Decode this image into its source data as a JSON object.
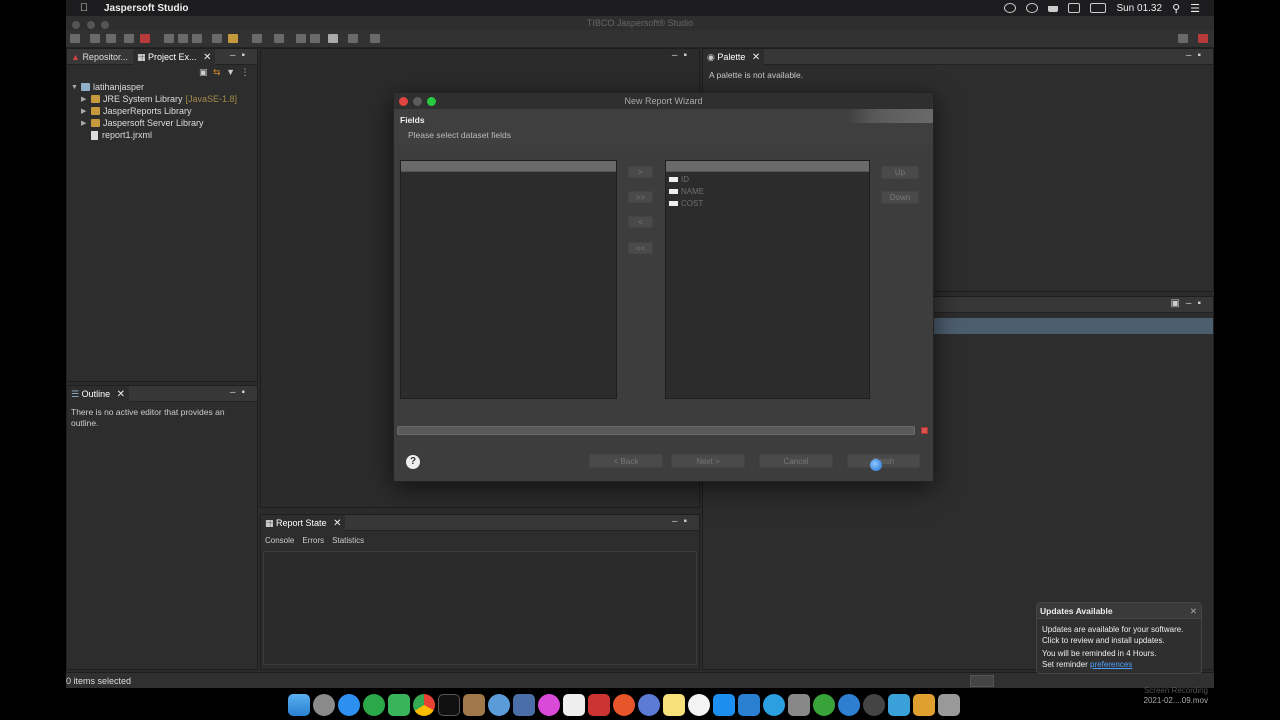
{
  "menubar": {
    "app_name": "Jaspersoft Studio",
    "clock": "Sun 01.32"
  },
  "window": {
    "title": "TIBCO Jaspersoft® Studio"
  },
  "project_panel": {
    "tabs": [
      {
        "label": "Repositor..."
      },
      {
        "label": "Project Ex..."
      }
    ],
    "tree": {
      "root": "latihanjasper",
      "items": [
        {
          "label": "JRE System Library",
          "suffix": "[JavaSE-1.8]"
        },
        {
          "label": "JasperReports Library"
        },
        {
          "label": "Jaspersoft Server Library"
        },
        {
          "label": "report1.jrxml"
        }
      ]
    }
  },
  "outline_panel": {
    "tab": "Outline",
    "message": "There is no active editor that provides an outline."
  },
  "palette_panel": {
    "tab": "Palette",
    "message": "A palette is not available."
  },
  "report_state_panel": {
    "tab": "Report State",
    "subtabs": [
      "Console",
      "Errors",
      "Statistics"
    ]
  },
  "status_bar": {
    "text": "0 items selected"
  },
  "dialog": {
    "title": "New Report Wizard",
    "section": "Fields",
    "instruction": "Please select dataset fields",
    "move_buttons": [
      ">",
      ">>",
      "<",
      "<<"
    ],
    "order_buttons": [
      "Up",
      "Down"
    ],
    "fields": [
      "ID",
      "NAME",
      "COST"
    ],
    "nav_buttons": {
      "back": "< Back",
      "next": "Next >",
      "cancel": "Cancel",
      "finish": "Finish"
    },
    "help": "?"
  },
  "notification": {
    "title": "Updates Available",
    "line1": "Updates are available for your software. Click to review and install updates.",
    "line2": "You will be reminded in 4 Hours.",
    "line3_prefix": "Set reminder ",
    "line3_link": "preferences"
  },
  "screen_recording": {
    "label": "Screen Recording",
    "filename": "2021-02....09.mov"
  },
  "colors": {
    "accent_link": "#4ea1ff",
    "window_bg": "#2b2b2b",
    "dialog_bg": "#3d3d3d",
    "selection_bar": "#4c5d6e"
  }
}
